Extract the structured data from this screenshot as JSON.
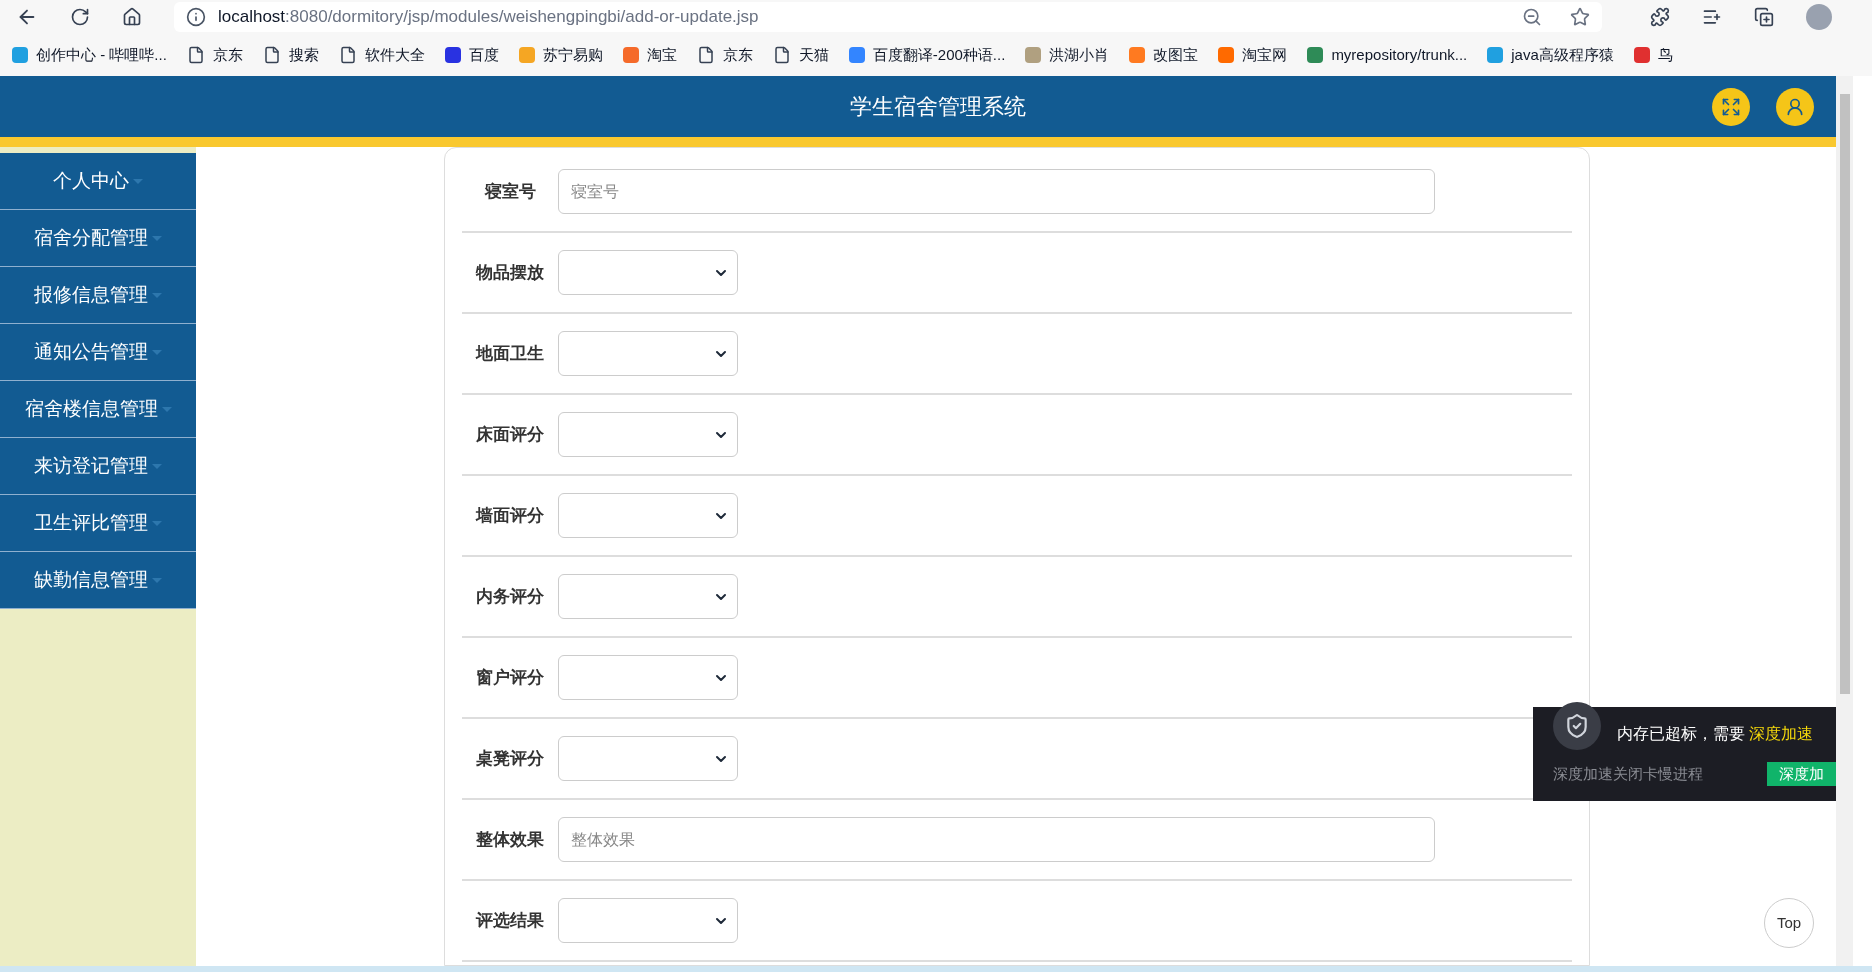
{
  "browser": {
    "url_host": "localhost",
    "url_rest": ":8080/dormitory/jsp/modules/weishengpingbi/add-or-update.jsp",
    "bookmarks": [
      {
        "label": "创作中心 - 哔哩哔...",
        "kind": "site",
        "color": "#20a0e0"
      },
      {
        "label": "京东",
        "kind": "page"
      },
      {
        "label": "搜索",
        "kind": "page"
      },
      {
        "label": "软件大全",
        "kind": "page"
      },
      {
        "label": "百度",
        "kind": "site",
        "color": "#2932e1"
      },
      {
        "label": "苏宁易购",
        "kind": "site",
        "color": "#f5a623"
      },
      {
        "label": "淘宝",
        "kind": "site",
        "color": "#f56a2a"
      },
      {
        "label": "京东",
        "kind": "page"
      },
      {
        "label": "天猫",
        "kind": "page"
      },
      {
        "label": "百度翻译-200种语...",
        "kind": "site",
        "color": "#3385ff"
      },
      {
        "label": "洪湖小肖",
        "kind": "site",
        "color": "#b0a080"
      },
      {
        "label": "改图宝",
        "kind": "site",
        "color": "#ff7a20"
      },
      {
        "label": "淘宝网",
        "kind": "site",
        "color": "#ff6a00"
      },
      {
        "label": "myrepository/trunk...",
        "kind": "site",
        "color": "#2e8b57"
      },
      {
        "label": "java高级程序猿",
        "kind": "site",
        "color": "#20a0e0"
      },
      {
        "label": "鸟",
        "kind": "site",
        "color": "#e03030"
      }
    ]
  },
  "header": {
    "title": "学生宿舍管理系统"
  },
  "sidebar": {
    "items": [
      {
        "label": "个人中心"
      },
      {
        "label": "宿舍分配管理"
      },
      {
        "label": "报修信息管理"
      },
      {
        "label": "通知公告管理"
      },
      {
        "label": "宿舍楼信息管理"
      },
      {
        "label": "来访登记管理"
      },
      {
        "label": "卫生评比管理"
      },
      {
        "label": "缺勤信息管理"
      }
    ]
  },
  "form": {
    "fields": [
      {
        "label": "寝室号",
        "kind": "text",
        "placeholder": "寝室号"
      },
      {
        "label": "物品摆放",
        "kind": "select"
      },
      {
        "label": "地面卫生",
        "kind": "select"
      },
      {
        "label": "床面评分",
        "kind": "select"
      },
      {
        "label": "墙面评分",
        "kind": "select"
      },
      {
        "label": "内务评分",
        "kind": "select"
      },
      {
        "label": "窗户评分",
        "kind": "select"
      },
      {
        "label": "桌凳评分",
        "kind": "select"
      },
      {
        "label": "整体效果",
        "kind": "text",
        "placeholder": "整体效果"
      },
      {
        "label": "评选结果",
        "kind": "select"
      }
    ]
  },
  "popup": {
    "message": "内存已超标，需要",
    "highlight": "深度加速",
    "subtext": "深度加速关闭卡慢进程",
    "button": "深度加"
  },
  "top_button": "Top"
}
